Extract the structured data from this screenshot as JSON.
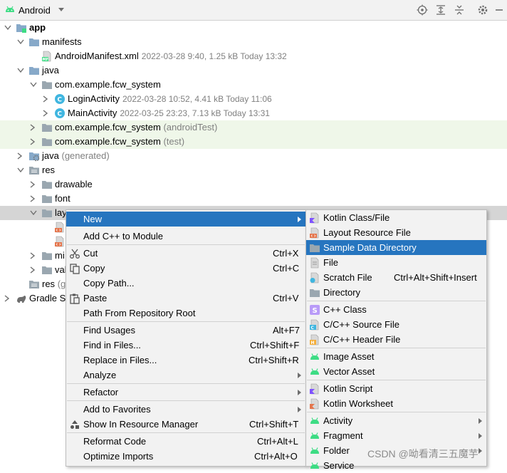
{
  "toolbar": {
    "view_label": "Android",
    "icons": [
      "android-icon",
      "chevron-down-icon",
      "locate-icon",
      "expand-all-icon",
      "collapse-all-icon",
      "gear-icon",
      "hide-icon"
    ]
  },
  "tree": {
    "app": "app",
    "manifests": "manifests",
    "android_manifest": {
      "name": "AndroidManifest.xml",
      "meta": "2022-03-28 9:40, 1.25 kB Today 13:32"
    },
    "java": "java",
    "pkg_main": "com.example.fcw_system",
    "login_activity": {
      "name": "LoginActivity",
      "meta": "2022-03-28 10:52, 4.41 kB Today 11:06"
    },
    "main_activity": {
      "name": "MainActivity",
      "meta": "2022-03-25 23:23, 7.13 kB Today 13:31"
    },
    "pkg_android_test": {
      "name": "com.example.fcw_system",
      "hint": "(androidTest)"
    },
    "pkg_test": {
      "name": "com.example.fcw_system",
      "hint": "(test)"
    },
    "java_generated": {
      "name": "java",
      "hint": "(generated)"
    },
    "res": "res",
    "drawable": "drawable",
    "font": "font",
    "layout_trunc": "lay",
    "mipmap_trunc": "mi",
    "values_trunc": "val",
    "res_generated": {
      "name": "res",
      "hint": "(g"
    },
    "gradle_trunc": "Gradle S"
  },
  "context_menu": {
    "items": [
      {
        "label": "New",
        "shortcut": "",
        "submenu": true
      },
      {
        "label": "Add C++ to Module",
        "shortcut": ""
      },
      {
        "label": "Cut",
        "shortcut": "Ctrl+X"
      },
      {
        "label": "Copy",
        "shortcut": "Ctrl+C"
      },
      {
        "label": "Copy Path...",
        "shortcut": ""
      },
      {
        "label": "Paste",
        "shortcut": "Ctrl+V"
      },
      {
        "label": "Path From Repository Root",
        "shortcut": ""
      },
      {
        "label": "Find Usages",
        "shortcut": "Alt+F7"
      },
      {
        "label": "Find in Files...",
        "shortcut": "Ctrl+Shift+F"
      },
      {
        "label": "Replace in Files...",
        "shortcut": "Ctrl+Shift+R"
      },
      {
        "label": "Analyze",
        "shortcut": "",
        "submenu": true
      },
      {
        "label": "Refactor",
        "shortcut": "",
        "submenu": true
      },
      {
        "label": "Add to Favorites",
        "shortcut": "",
        "submenu": true
      },
      {
        "label": "Show In Resource Manager",
        "shortcut": "Ctrl+Shift+T"
      },
      {
        "label": "Reformat Code",
        "shortcut": "Ctrl+Alt+L"
      },
      {
        "label": "Optimize Imports",
        "shortcut": "Ctrl+Alt+O"
      }
    ]
  },
  "new_submenu": {
    "items": [
      {
        "label": "Kotlin Class/File",
        "shortcut": ""
      },
      {
        "label": "Layout Resource File",
        "shortcut": ""
      },
      {
        "label": "Sample Data Directory",
        "shortcut": ""
      },
      {
        "label": "File",
        "shortcut": ""
      },
      {
        "label": "Scratch File",
        "shortcut": "Ctrl+Alt+Shift+Insert"
      },
      {
        "label": "Directory",
        "shortcut": ""
      },
      {
        "label": "C++ Class",
        "shortcut": ""
      },
      {
        "label": "C/C++ Source File",
        "shortcut": ""
      },
      {
        "label": "C/C++ Header File",
        "shortcut": ""
      },
      {
        "label": "Image Asset",
        "shortcut": ""
      },
      {
        "label": "Vector Asset",
        "shortcut": ""
      },
      {
        "label": "Kotlin Script",
        "shortcut": ""
      },
      {
        "label": "Kotlin Worksheet",
        "shortcut": ""
      },
      {
        "label": "Activity",
        "shortcut": "",
        "submenu": true
      },
      {
        "label": "Fragment",
        "shortcut": "",
        "submenu": true
      },
      {
        "label": "Folder",
        "shortcut": "",
        "submenu": true
      },
      {
        "label": "Service",
        "shortcut": "",
        "submenu": true
      }
    ]
  },
  "watermark": "CSDN @呦看清三五魔芋",
  "colors": {
    "highlight": "#2675bf",
    "android_green": "#3ddc84",
    "folder_blue": "#87a9c9",
    "test_bg": "#eff7e9"
  }
}
